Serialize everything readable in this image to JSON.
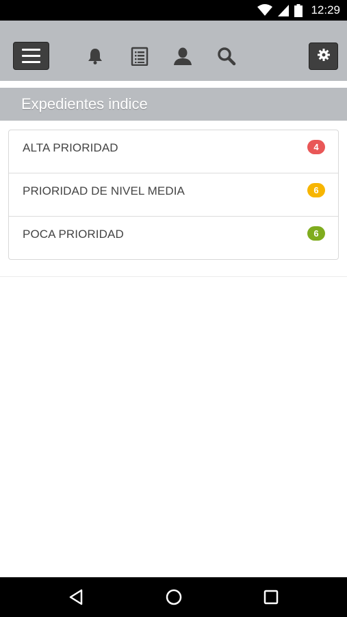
{
  "status_bar": {
    "time": "12:29",
    "icons": [
      "wifi-icon",
      "signal-icon",
      "battery-icon"
    ]
  },
  "toolbar": {
    "menu_icon": "hamburger-menu-icon",
    "icons": [
      "bell-icon",
      "list-icon",
      "user-icon",
      "search-icon"
    ],
    "settings_icon": "gear-icon",
    "colors": {
      "background": "#b9bcc0",
      "button": "#3f3f3f"
    }
  },
  "section": {
    "title": "Expedientes indice"
  },
  "priorities": [
    {
      "label": "ALTA PRIORIDAD",
      "count": "4",
      "color": "#e95757"
    },
    {
      "label": "PRIORIDAD DE NIVEL MEDIA",
      "count": "6",
      "color": "#f7b500"
    },
    {
      "label": "POCA PRIORIDAD",
      "count": "6",
      "color": "#7fac1e"
    }
  ],
  "nav_bar": {
    "icons": [
      "back-icon",
      "home-icon",
      "recents-icon"
    ]
  }
}
